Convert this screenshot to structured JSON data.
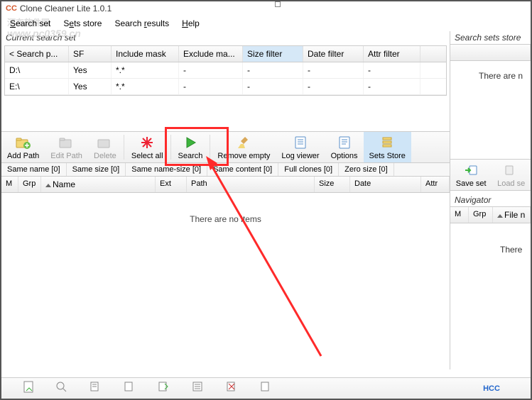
{
  "app": {
    "icon_text": "CC",
    "title": "Clone Cleaner Lite 1.0.1"
  },
  "menu": {
    "search_set": "Search set",
    "sets_store": "Sets store",
    "search_results": "Search results",
    "help": "Help"
  },
  "watermark": {
    "line1": "河东软件园",
    "line2": "www.pc0359.cn"
  },
  "section": {
    "current_search_set": "Current search set",
    "search_sets_store": "Search sets store",
    "navigator": "Navigator"
  },
  "grid_headers": {
    "search_p": "< Search p...",
    "sf": "SF",
    "include_mask": "Include mask",
    "exclude_mask": "Exclude ma...",
    "size_filter": "Size filter",
    "date_filter": "Date filter",
    "attr_filter": "Attr filter"
  },
  "rows": [
    {
      "path": "D:\\",
      "sf": "Yes",
      "mask": "*.*",
      "ex": "-",
      "size": "-",
      "date": "-",
      "attr": "-"
    },
    {
      "path": "E:\\",
      "sf": "Yes",
      "mask": "*.*",
      "ex": "-",
      "size": "-",
      "date": "-",
      "attr": "-"
    }
  ],
  "toolbar": {
    "add_path": "Add Path",
    "edit_path": "Edit Path",
    "delete": "Delete",
    "select_all": "Select all",
    "search": "Search",
    "remove_empty": "Remove empty",
    "log_viewer": "Log viewer",
    "options": "Options",
    "sets_store": "Sets Store",
    "save_set": "Save set",
    "load_set": "Load se"
  },
  "tabs": {
    "same_name": "Same name [0]",
    "same_size": "Same size [0]",
    "same_name_size": "Same name-size [0]",
    "same_content": "Same content [0]",
    "full_clones": "Full clones [0]",
    "zero_size": "Zero size [0]"
  },
  "result_cols": {
    "m": "M",
    "grp": "Grp",
    "name": "Name",
    "ext": "Ext",
    "path": "Path",
    "size": "Size",
    "date": "Date",
    "attr": "Attr"
  },
  "empty": {
    "no_items": "There are no items",
    "there_are_n": "There are n",
    "there": "There"
  },
  "nav_cols": {
    "m": "M",
    "grp": "Grp",
    "file_n": "File n"
  },
  "footer": {
    "hcc": "HCC"
  }
}
